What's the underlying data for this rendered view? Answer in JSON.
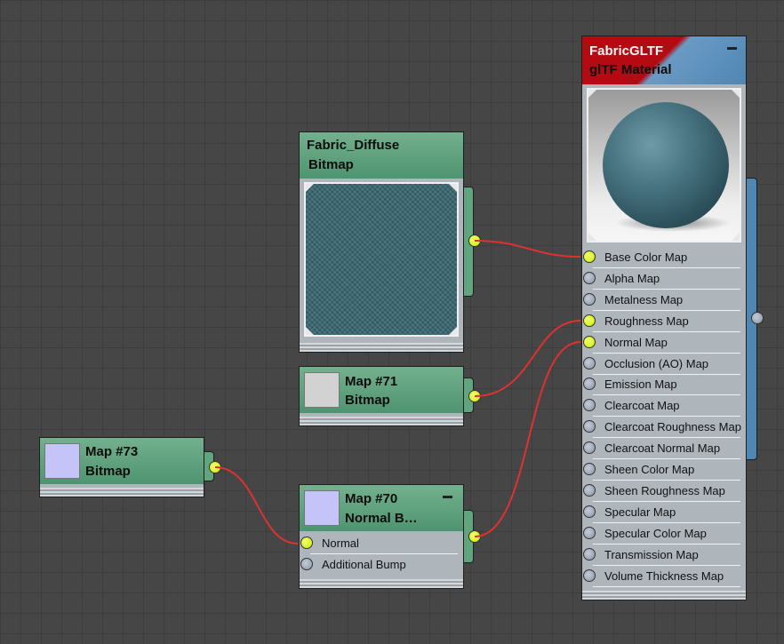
{
  "canvas": {
    "background": "#464646",
    "grid_color": "#3d3d3d"
  },
  "colors": {
    "wire": "#e03030",
    "node_header": "#5a9e78",
    "socket_active": "#d4f000",
    "socket_inactive": "#9aa6b2",
    "material_side_bar": "#4e86b4"
  },
  "nodes": {
    "fabric_diffuse": {
      "name": "Fabric_Diffuse",
      "type": "Bitmap",
      "preview": "teal-fabric-texture"
    },
    "map71": {
      "name": "Map #71",
      "type": "Bitmap",
      "swatch": "#d2d2d2"
    },
    "map73": {
      "name": "Map #73",
      "type": "Bitmap",
      "swatch": "#c4c4f8"
    },
    "map70": {
      "name": "Map #70",
      "type": "Normal B…",
      "swatch": "#c4c4f8",
      "slots": [
        {
          "label": "Normal",
          "connected": true
        },
        {
          "label": "Additional Bump",
          "connected": false
        }
      ]
    },
    "material": {
      "name": "FabricGLTF",
      "type": "glTF Material",
      "preview": "fabric-sphere",
      "slots": [
        {
          "label": "Base Color Map",
          "connected": true
        },
        {
          "label": "Alpha Map",
          "connected": false
        },
        {
          "label": "Metalness Map",
          "connected": false
        },
        {
          "label": "Roughness Map",
          "connected": true
        },
        {
          "label": "Normal Map",
          "connected": true
        },
        {
          "label": "Occlusion (AO) Map",
          "connected": false
        },
        {
          "label": "Emission Map",
          "connected": false
        },
        {
          "label": "Clearcoat Map",
          "connected": false
        },
        {
          "label": "Clearcoat Roughness Map",
          "connected": false
        },
        {
          "label": "Clearcoat Normal Map",
          "connected": false
        },
        {
          "label": "Sheen Color Map",
          "connected": false
        },
        {
          "label": "Sheen Roughness Map",
          "connected": false
        },
        {
          "label": "Specular Map",
          "connected": false
        },
        {
          "label": "Specular Color Map",
          "connected": false
        },
        {
          "label": "Transmission Map",
          "connected": false
        },
        {
          "label": "Volume Thickness Map",
          "connected": false
        }
      ]
    }
  },
  "connections": [
    {
      "from": "Fabric_Diffuse",
      "to": "Base Color Map"
    },
    {
      "from": "Map #71",
      "to": "Roughness Map"
    },
    {
      "from": "Map #70",
      "to": "Normal Map"
    },
    {
      "from": "Map #73",
      "to": "Normal"
    }
  ]
}
